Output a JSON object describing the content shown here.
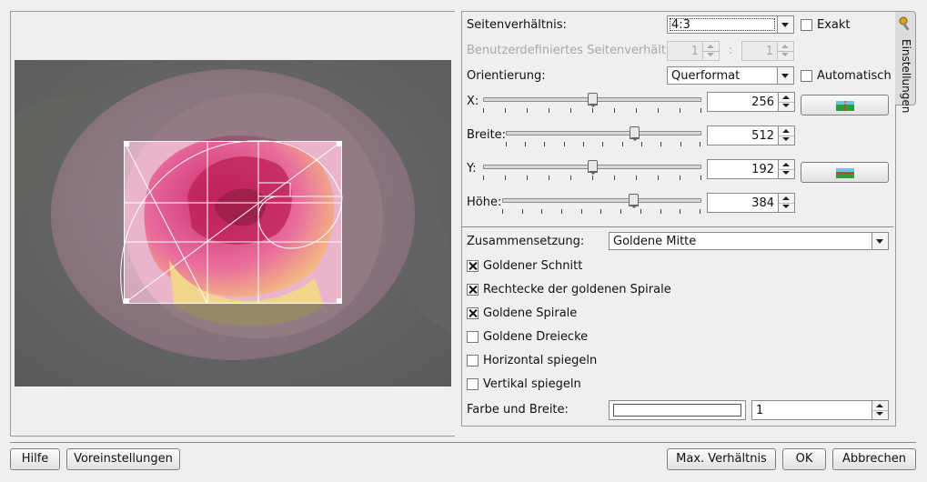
{
  "settings": {
    "aspect_ratio_label": "Seitenverhältnis:",
    "aspect_ratio_value": "4:3",
    "exact_label": "Exakt",
    "exact_checked": false,
    "custom_ratio_label": "Benutzerdefiniertes Seitenverhältnis:",
    "custom_ratio_left": "1",
    "custom_ratio_sep": ":",
    "custom_ratio_right": "1",
    "orientation_label": "Orientierung:",
    "orientation_value": "Querformat",
    "auto_label": "Automatisch",
    "auto_checked": false,
    "x_label": "X:",
    "x_value": "256",
    "width_label": "Breite:",
    "width_value": "512",
    "y_label": "Y:",
    "y_value": "192",
    "height_label": "Höhe:",
    "height_value": "384",
    "composition_label": "Zusammensetzung:",
    "composition_value": "Goldene Mitte",
    "options": [
      {
        "label": "Goldener Schnitt",
        "checked": true
      },
      {
        "label": "Rechtecke der goldenen Spirale",
        "checked": true
      },
      {
        "label": "Goldene Spirale",
        "checked": true
      },
      {
        "label": "Goldene Dreiecke",
        "checked": false
      },
      {
        "label": "Horizontal spiegeln",
        "checked": false
      },
      {
        "label": "Vertikal spiegeln",
        "checked": false
      }
    ],
    "color_width_label": "Farbe und Breite:",
    "line_color": "#ffffff",
    "line_width": "1"
  },
  "side_tab": {
    "label": "Einstellungen",
    "icon": "settings-tools-icon"
  },
  "buttons": {
    "help": "Hilfe",
    "defaults": "Voreinstellungen",
    "max_ratio": "Max. Verhältnis",
    "ok": "OK",
    "cancel": "Abbrechen"
  },
  "colors": {
    "accent": "#d81b60",
    "crop_overlay": "#ffffff"
  }
}
